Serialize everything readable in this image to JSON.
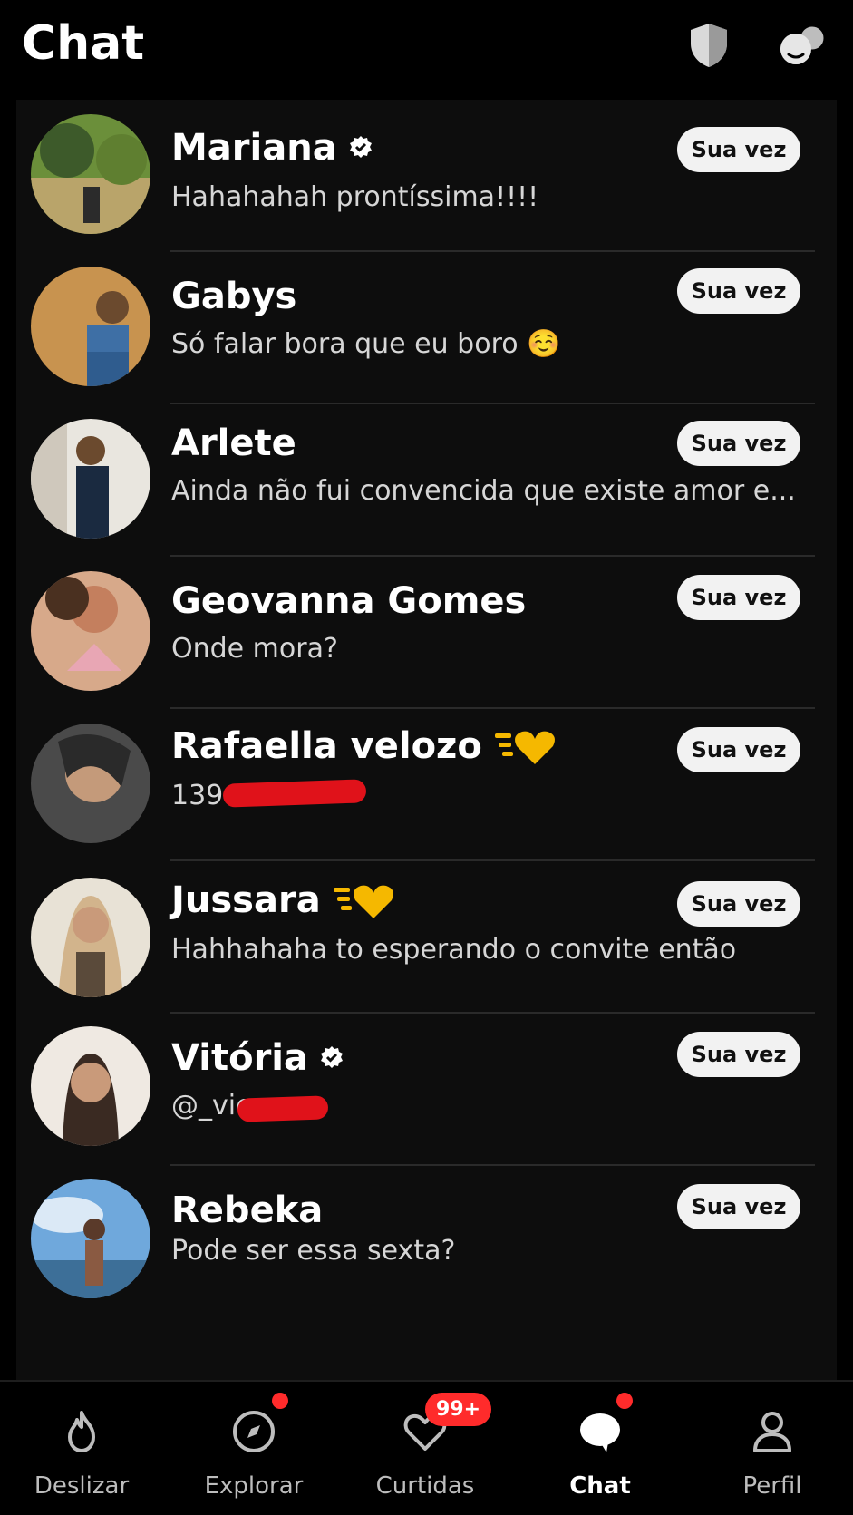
{
  "header": {
    "title": "Chat",
    "shield_icon": "shield-icon",
    "people_icon": "people-icon"
  },
  "chats": [
    {
      "name": "Mariana",
      "message": "Hahahahah prontíssima!!!!",
      "status": "Sua vez",
      "badge": "verified",
      "avatar_colors": [
        "#6b8f3a",
        "#b9a46a",
        "#3d5a2a"
      ]
    },
    {
      "name": "Gabys",
      "message": "Só falar bora que eu boro ☺️",
      "status": "Sua vez",
      "badge": "",
      "avatar_colors": [
        "#c8934f",
        "#a7703a",
        "#3e6fa5"
      ]
    },
    {
      "name": "Arlete",
      "message": "Ainda não fui convencida que existe amor e...",
      "status": "Sua vez",
      "badge": "",
      "avatar_colors": [
        "#e9e6df",
        "#bfb6a6",
        "#1a2a40"
      ]
    },
    {
      "name": "Geovanna Gomes",
      "message": "Onde mora?",
      "status": "Sua vez",
      "badge": "",
      "avatar_colors": [
        "#d7a98a",
        "#c47f5e",
        "#e8a6b4"
      ]
    },
    {
      "name": "Rafaella velozo",
      "message": "139",
      "status": "Sua vez",
      "badge": "hearts",
      "avatar_colors": [
        "#4a4a4a",
        "#c49a7a",
        "#2a2a2a"
      ]
    },
    {
      "name": "Jussara",
      "message": "Hahhahaha to esperando o convite então",
      "status": "Sua vez",
      "badge": "hearts",
      "avatar_colors": [
        "#e8e2d6",
        "#d2b48c",
        "#5a4a3a"
      ]
    },
    {
      "name": "Vitória",
      "message": "@_vic",
      "status": "Sua vez",
      "badge": "verified",
      "avatar_colors": [
        "#efe9e2",
        "#c99a7a",
        "#3a2a22"
      ]
    },
    {
      "name": "Rebeka",
      "message": "Pode ser essa sexta?",
      "status": "Sua vez",
      "badge": "",
      "avatar_colors": [
        "#6fa8dc",
        "#dbe9f6",
        "#3d6f98"
      ]
    }
  ],
  "nav": {
    "items": [
      {
        "label": "Deslizar",
        "icon": "flame-icon",
        "active": false,
        "dot": false,
        "badge": ""
      },
      {
        "label": "Explorar",
        "icon": "compass-icon",
        "active": false,
        "dot": true,
        "badge": ""
      },
      {
        "label": "Curtidas",
        "icon": "heart-icon",
        "active": false,
        "dot": false,
        "badge": "99+"
      },
      {
        "label": "Chat",
        "icon": "chat-icon",
        "active": true,
        "dot": true,
        "badge": ""
      },
      {
        "label": "Perfil",
        "icon": "person-icon",
        "active": false,
        "dot": false,
        "badge": ""
      }
    ]
  }
}
